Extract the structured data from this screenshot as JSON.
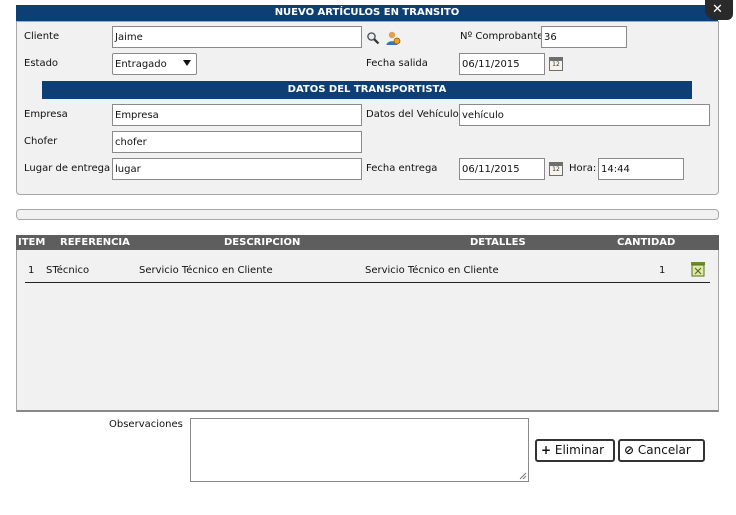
{
  "dialog": {
    "title": "NUEVO ARTÍCULOS EN TRANSITO",
    "close_glyph": "✕"
  },
  "form": {
    "cliente_label": "Cliente",
    "cliente_value": "Jaime",
    "comprobante_label": "Nº Comprobante",
    "comprobante_value": "36",
    "estado_label": "Estado",
    "estado_selected": "Entragado",
    "fecha_salida_label": "Fecha salida",
    "fecha_salida_value": "06/11/2015"
  },
  "transport": {
    "title": "DATOS DEL TRANSPORTISTA",
    "empresa_label": "Empresa",
    "empresa_value": "Empresa",
    "vehiculo_label": "Datos del Vehículo",
    "vehiculo_value": "vehículo",
    "chofer_label": "Chofer",
    "chofer_value": "chofer",
    "lugar_label": "Lugar de entrega",
    "lugar_value": "lugar",
    "fecha_entrega_label": "Fecha entrega",
    "fecha_entrega_value": "06/11/2015",
    "hora_label": "Hora:",
    "hora_value": "14:44"
  },
  "table": {
    "headers": [
      "ITEM",
      "REFERENCIA",
      "DESCRIPCION",
      "DETALLES",
      "CANTIDAD"
    ],
    "rows": [
      {
        "item": "1",
        "referencia": "STécnico",
        "descripcion": "Servicio Técnico en Cliente",
        "detalles": "Servicio Técnico en Cliente",
        "cantidad": "1"
      }
    ]
  },
  "footer": {
    "observaciones_label": "Observaciones",
    "observaciones_value": "",
    "eliminar_label": "Eliminar",
    "cancelar_label": "Cancelar"
  },
  "icons": {
    "search": "search-icon",
    "user": "user-icon",
    "calendar": "calendar-icon",
    "delete_row": "delete-row-icon",
    "close": "close-icon",
    "plus": "plus-icon",
    "cancel": "cancel-icon"
  },
  "colors": {
    "header_bar": "#0e3f74",
    "table_header": "#5e5e5e",
    "panel_bg": "#f1f1f1"
  }
}
